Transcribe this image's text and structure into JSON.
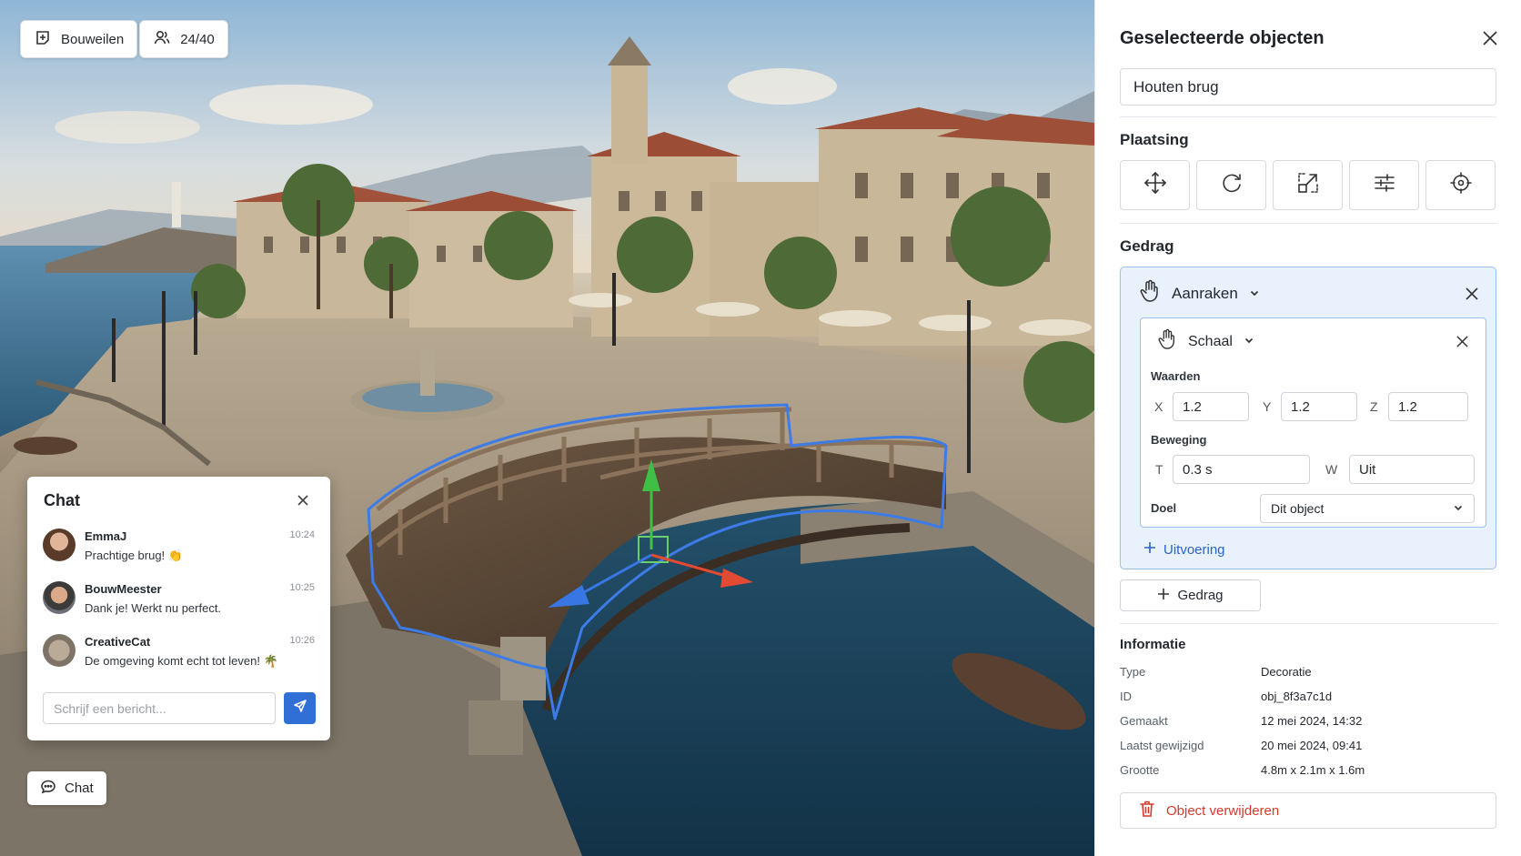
{
  "toolbar": {
    "build_mode_label": "Bouweilen",
    "players_label": "24/40"
  },
  "chat": {
    "title": "Chat",
    "messages": [
      {
        "user": "EmmaJ",
        "time": "10:24",
        "text": "Prachtige brug! 👏"
      },
      {
        "user": "BouwMeester",
        "time": "10:25",
        "text": "Dank je! Werkt nu perfect."
      },
      {
        "user": "CreativeCat",
        "time": "10:26",
        "text": "De omgeving komt echt tot leven! 🌴"
      }
    ],
    "input_placeholder": "Schrijf een bericht...",
    "toggle_label": "Chat"
  },
  "panel": {
    "title": "Geselecteerde objecten",
    "object_name": "Houten brug",
    "placement_label": "Plaatsing",
    "behavior_label": "Gedrag",
    "behavior": {
      "trigger": "Aanraken",
      "action": "Schaal",
      "values_label": "Waarden",
      "x_label": "X",
      "x": "1.2",
      "y_label": "Y",
      "y": "1.2",
      "z_label": "Z",
      "z": "1.2",
      "motion_label": "Beweging",
      "t_label": "T",
      "t": "0.3 s",
      "w_label": "W",
      "w": "Uit",
      "target_label": "Doel",
      "target": "Dit object",
      "add_execution": "Uitvoering"
    },
    "add_behavior": "Gedrag",
    "info": {
      "title": "Informatie",
      "rows": [
        {
          "key": "Type",
          "value": "Decoratie"
        },
        {
          "key": "ID",
          "value": "obj_8f3a7c1d"
        },
        {
          "key": "Gemaakt",
          "value": "12 mei 2024, 14:32"
        },
        {
          "key": "Laatst gewijzigd",
          "value": "20 mei 2024, 09:41"
        },
        {
          "key": "Grootte",
          "value": "4.8m x 2.1m x 1.6m"
        }
      ]
    },
    "delete_label": "Object verwijderen"
  },
  "colors": {
    "accent": "#2f6fd6",
    "selection_outline": "#3d7be6",
    "danger": "#d23a2e",
    "behavior_bg": "#e9f1fc"
  }
}
